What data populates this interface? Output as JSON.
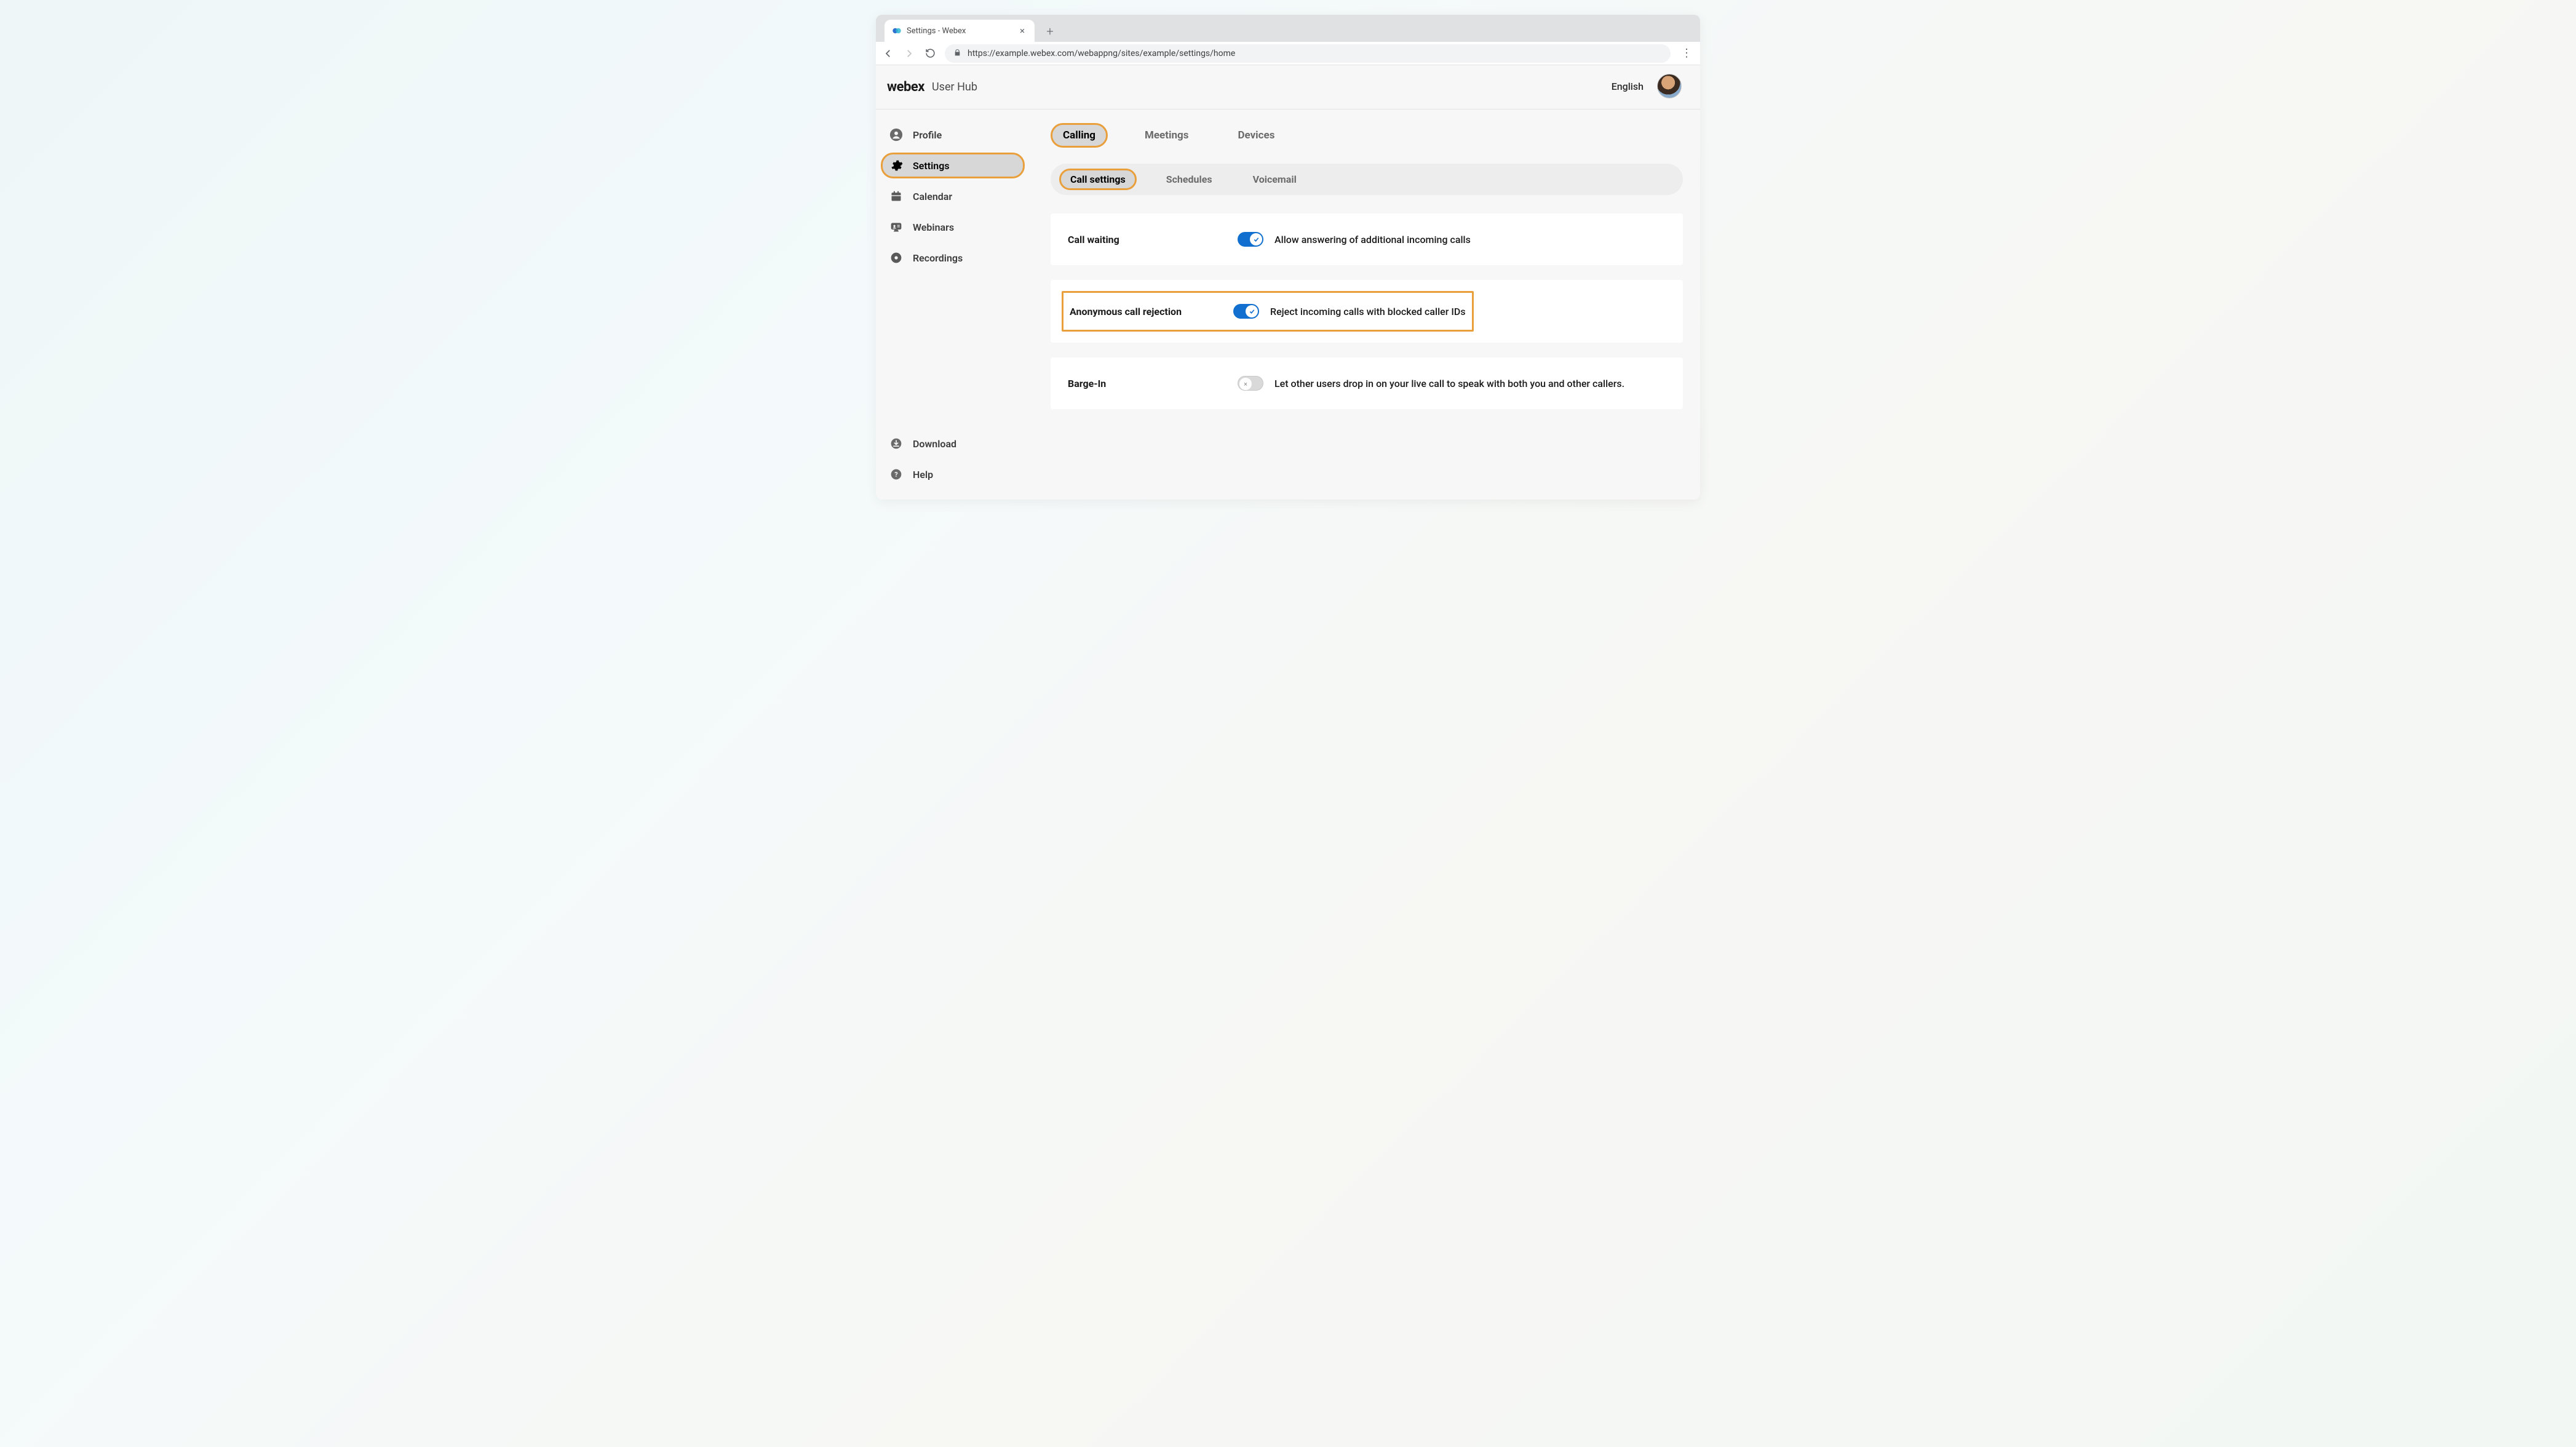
{
  "browser": {
    "tab_title": "Settings - Webex",
    "url": "https://example.webex.com/webappng/sites/example/settings/home"
  },
  "brand": {
    "logo": "webex",
    "sub": "User Hub"
  },
  "top_right": {
    "language": "English"
  },
  "sidebar": {
    "items": [
      {
        "label": "Profile"
      },
      {
        "label": "Settings"
      },
      {
        "label": "Calendar"
      },
      {
        "label": "Webinars"
      },
      {
        "label": "Recordings"
      }
    ],
    "bottom": [
      {
        "label": "Download"
      },
      {
        "label": "Help"
      }
    ]
  },
  "tabs_primary": [
    {
      "label": "Calling"
    },
    {
      "label": "Meetings"
    },
    {
      "label": "Devices"
    }
  ],
  "tabs_secondary": [
    {
      "label": "Call settings"
    },
    {
      "label": "Schedules"
    },
    {
      "label": "Voicemail"
    }
  ],
  "settings": {
    "call_waiting": {
      "title": "Call waiting",
      "desc": "Allow answering of additional incoming calls",
      "on": true
    },
    "anon_reject": {
      "title": "Anonymous call rejection",
      "desc": "Reject incoming calls with blocked caller IDs",
      "on": true
    },
    "barge_in": {
      "title": "Barge-In",
      "desc": "Let other users drop in on your live call to speak with both you and other callers.",
      "on": false
    }
  }
}
